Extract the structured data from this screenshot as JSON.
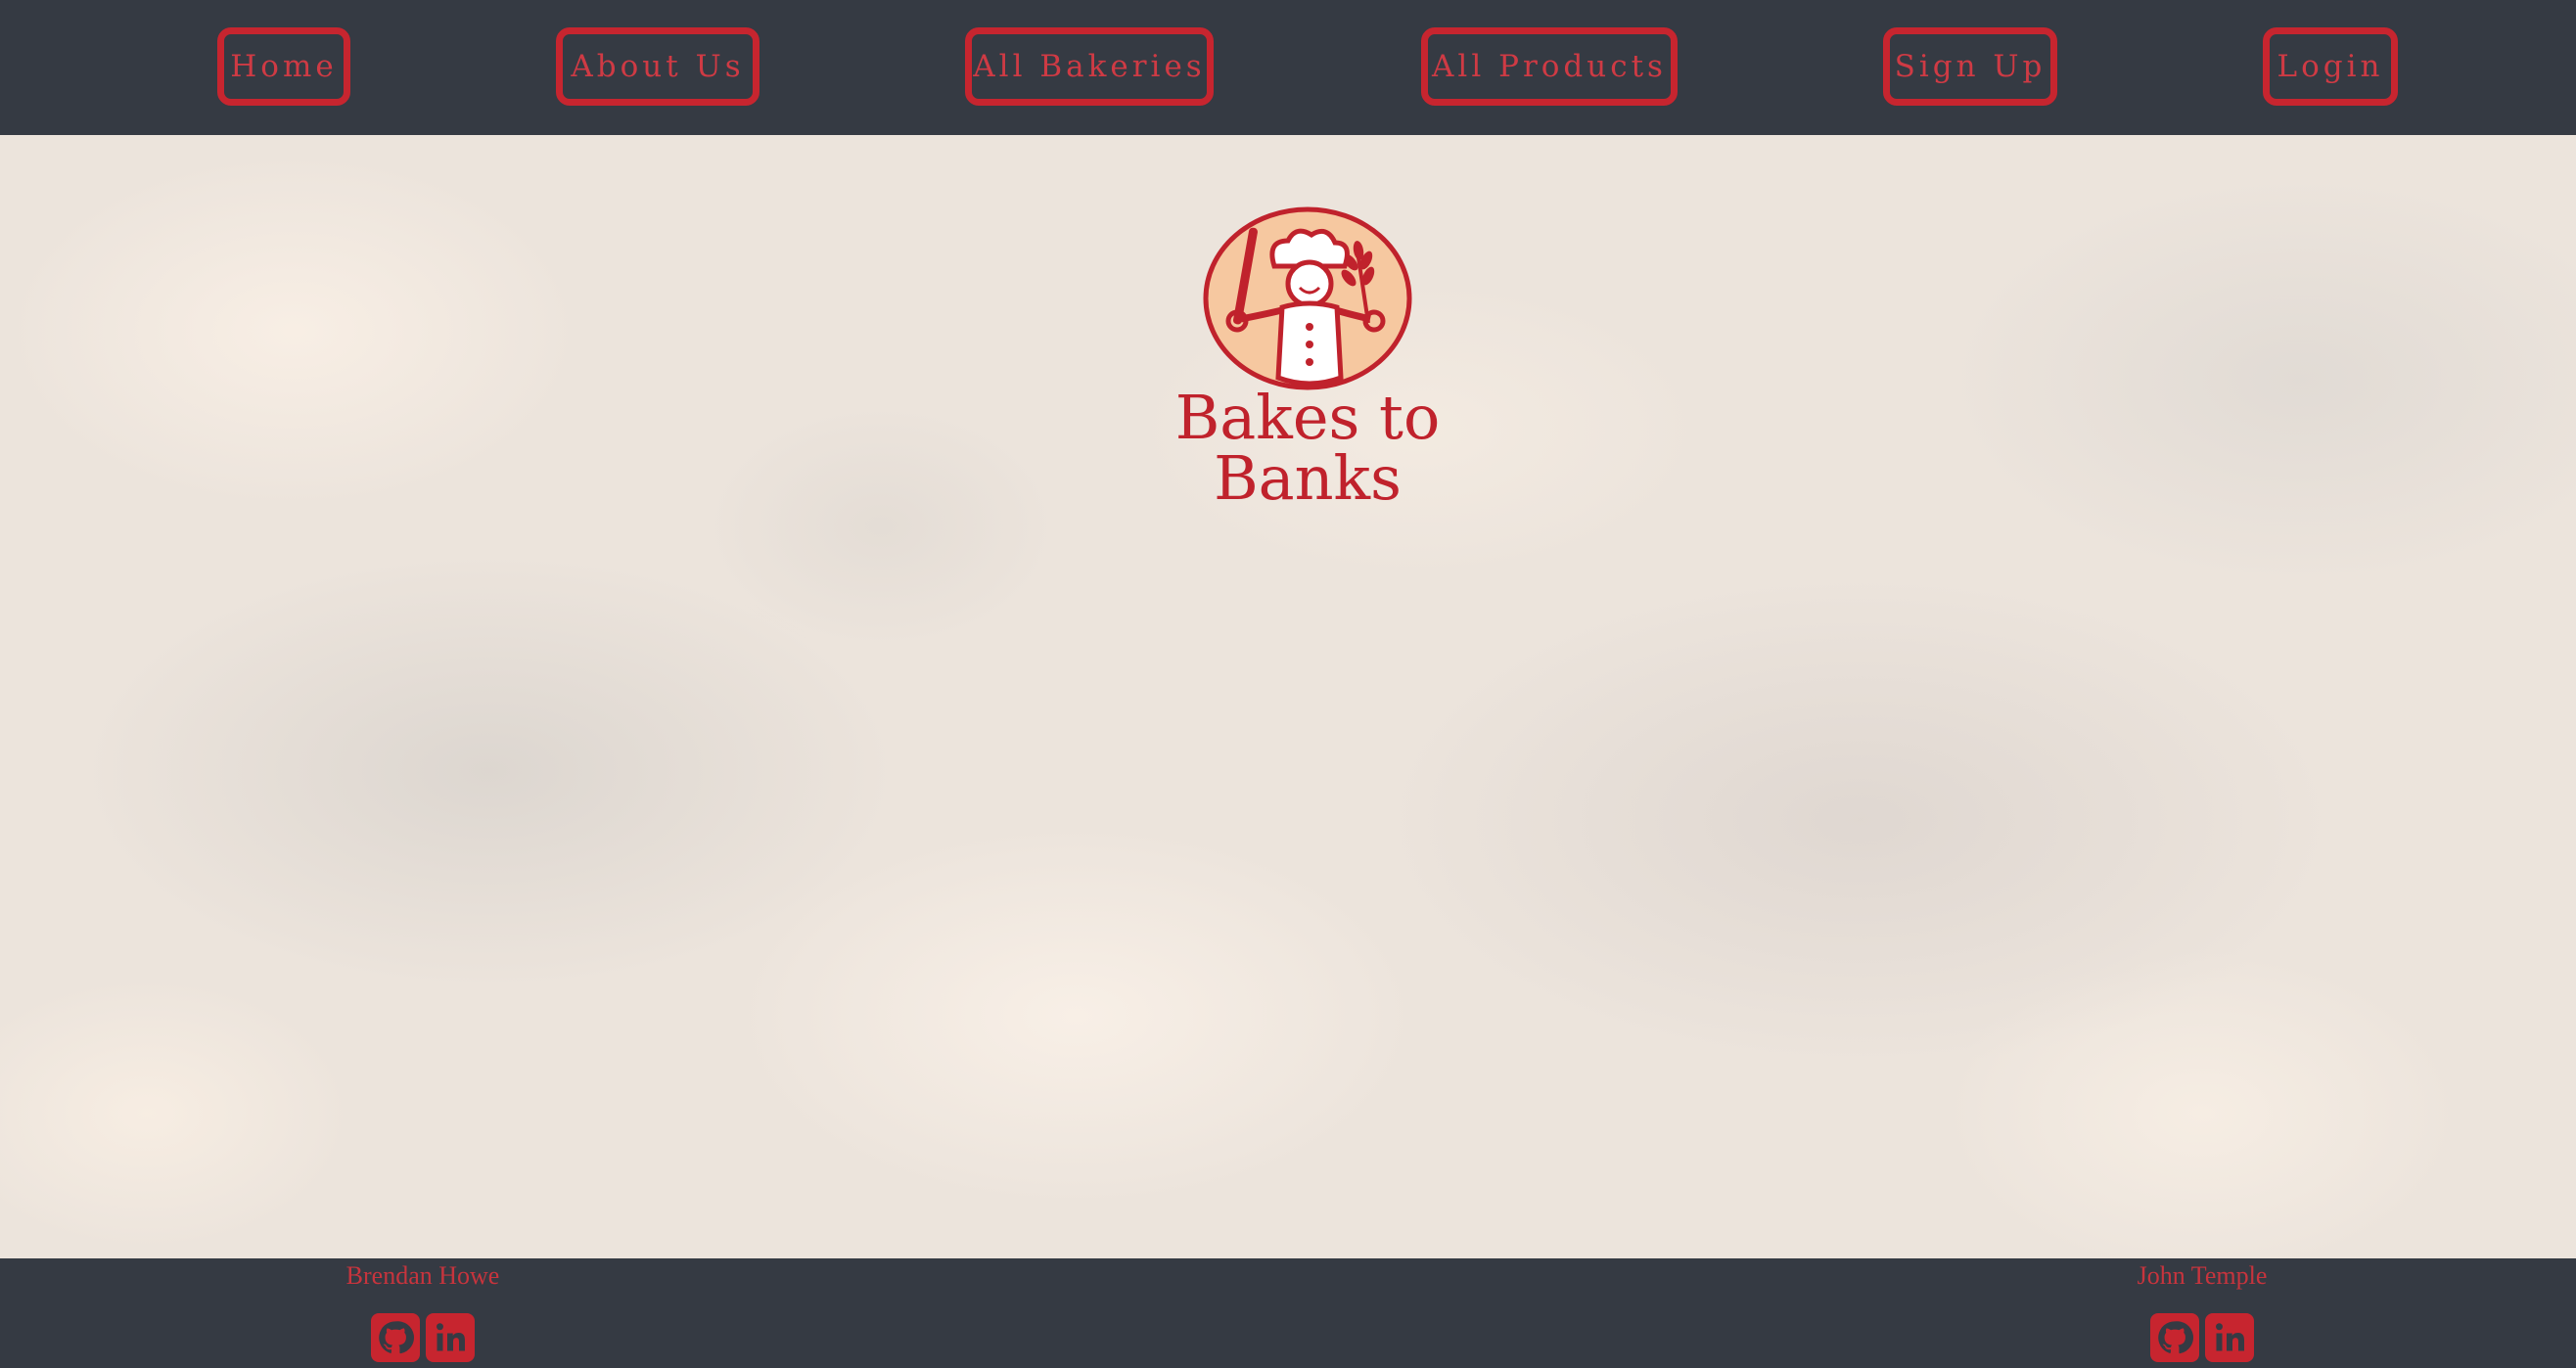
{
  "nav": {
    "items": [
      {
        "label": "Home"
      },
      {
        "label": "About Us"
      },
      {
        "label": "All Bakeries"
      },
      {
        "label": "All Products"
      },
      {
        "label": "Sign Up"
      },
      {
        "label": "Login"
      }
    ]
  },
  "brand": {
    "name": "Bakes to Banks",
    "logo_icon": "baker-chef-icon"
  },
  "footer": {
    "authors": [
      {
        "name": "Brendan Howe",
        "icons": [
          "github-icon",
          "linkedin-icon"
        ]
      },
      {
        "name": "John Temple",
        "icons": [
          "github-icon",
          "linkedin-icon"
        ]
      }
    ]
  },
  "colors": {
    "bar_background": "#353a43",
    "accent_red": "#c7252f",
    "main_background": "#ece4dc",
    "logo_orange": "#f6c8a0"
  }
}
